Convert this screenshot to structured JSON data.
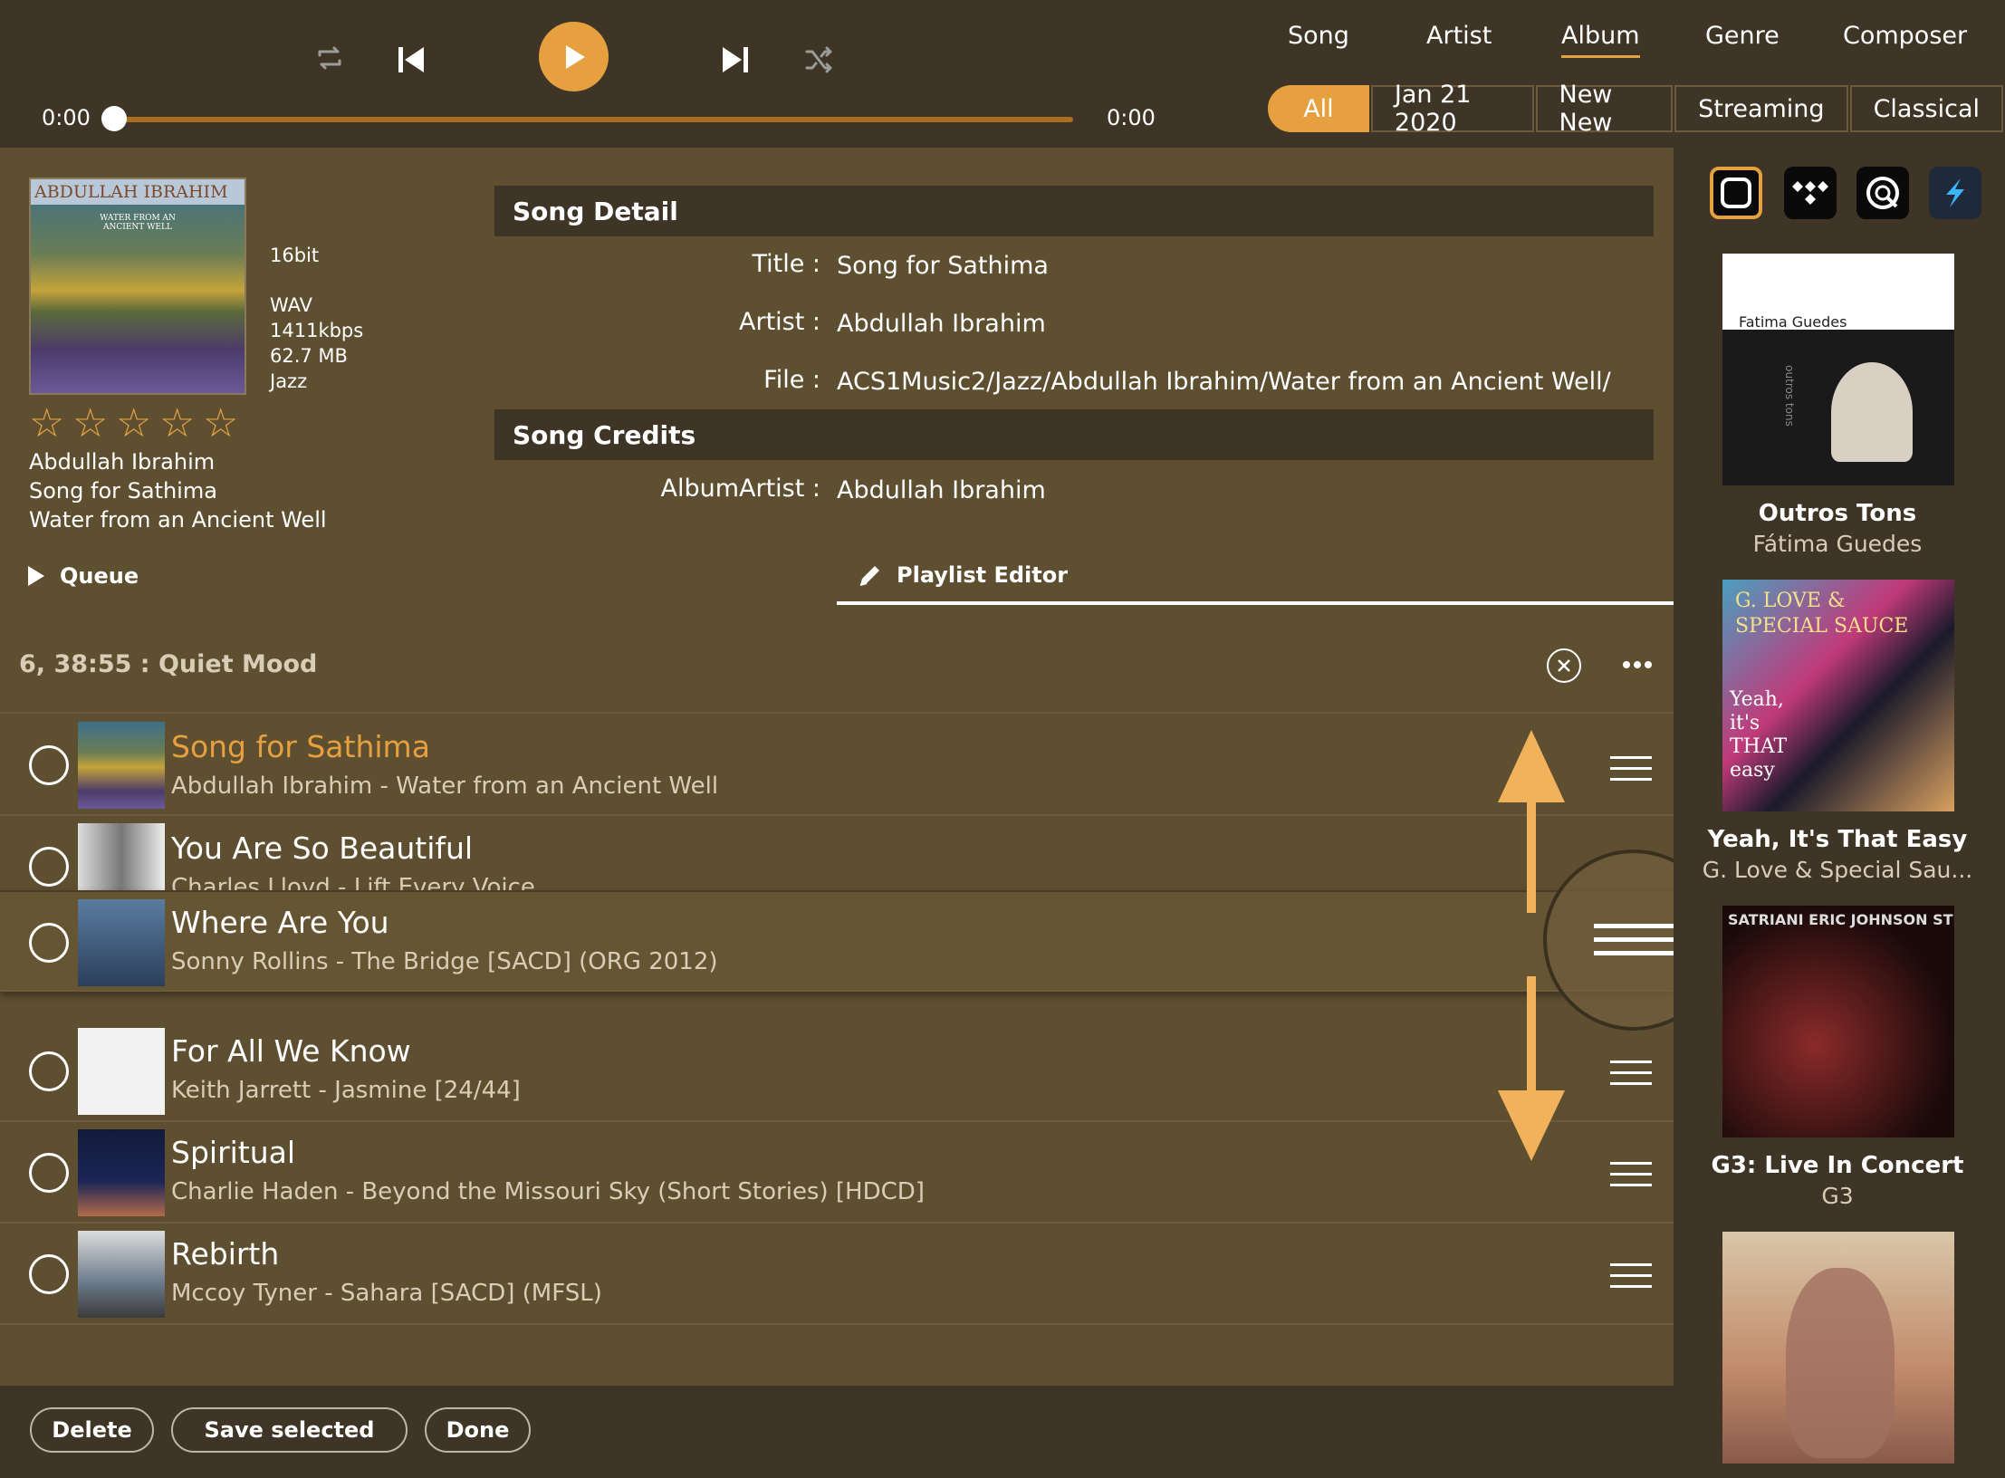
{
  "player": {
    "elapsed": "0:00",
    "duration": "0:00",
    "progress": 0.0
  },
  "nav": {
    "tabs": [
      "Song",
      "Artist",
      "Album",
      "Genre",
      "Composer"
    ],
    "active_tab": "Album",
    "filters": [
      "All",
      "Jan 21 2020",
      "New New",
      "Streaming",
      "Classical"
    ],
    "active_filter": "All"
  },
  "now_playing": {
    "cover_text": "ABDULLAH IBRAHIM",
    "cover_subtext": "WATER FROM AN ANCIENT WELL",
    "bit_depth": "16bit",
    "format": "WAV",
    "bitrate": "1411kbps",
    "size": "62.7 MB",
    "genre": "Jazz",
    "rating": 0,
    "artist": "Abdullah Ibrahim",
    "title": "Song for Sathima",
    "album": "Water from an Ancient Well",
    "queue_label": "Queue"
  },
  "song_detail": {
    "header": "Song Detail",
    "title_label": "Title :",
    "title": "Song for Sathima",
    "artist_label": "Artist :",
    "artist": "Abdullah Ibrahim",
    "file_label": "File :",
    "file": "ACS1Music2/Jazz/Abdullah Ibrahim/Water from an Ancient Well/",
    "credits_header": "Song Credits",
    "albumartist_label": "AlbumArtist :",
    "albumartist": "Abdullah Ibrahim"
  },
  "playlist_editor": {
    "tab_label": "Playlist Editor",
    "summary": "6, 38:55 : Quiet Mood",
    "rows": [
      {
        "title": "Song for Sathima",
        "subtitle": "Abdullah Ibrahim - Water from an Ancient Well",
        "playing": true
      },
      {
        "title": "You Are So Beautiful",
        "subtitle": "Charles Lloyd - Lift Every Voice",
        "playing": false
      },
      {
        "title": "Where Are You",
        "subtitle": "Sonny Rollins - The Bridge [SACD] (ORG 2012)",
        "playing": false
      },
      {
        "title": "For All We Know",
        "subtitle": "Keith Jarrett - Jasmine [24/44]",
        "playing": false
      },
      {
        "title": "Spiritual",
        "subtitle": "Charlie Haden - Beyond the Missouri Sky (Short Stories) [HDCD]",
        "playing": false
      },
      {
        "title": "Rebirth",
        "subtitle": "Mccoy Tyner - Sahara [SACD] (MFSL)",
        "playing": false
      }
    ],
    "actions": {
      "delete": "Delete",
      "save": "Save selected",
      "done": "Done"
    }
  },
  "side_albums": [
    {
      "name": "Outros Tons",
      "artist": "Fátima Guedes",
      "cover_text": "Fatima Guedes",
      "cover_vertical": "outros tons"
    },
    {
      "name": "Yeah, It's That Easy",
      "artist": "G. Love & Special Sau...",
      "cover_text": "G. LOVE & SPECIAL SAUCE",
      "cover_subtext": "Yeah, it's THAT easy"
    },
    {
      "name": "G3: Live In Concert",
      "artist": "G3",
      "cover_text": "SATRIANI ERIC JOHNSON STEVE VAI"
    },
    {
      "name": "",
      "artist": ""
    }
  ],
  "colors": {
    "accent": "#e6a03f",
    "bar": "#3f3526",
    "body": "#5f4f31"
  },
  "icons": [
    "repeat-icon",
    "previous-icon",
    "play-icon",
    "next-icon",
    "shuffle-icon",
    "close-circle-icon",
    "more-icon",
    "pencil-icon",
    "drag-handle-icon"
  ]
}
